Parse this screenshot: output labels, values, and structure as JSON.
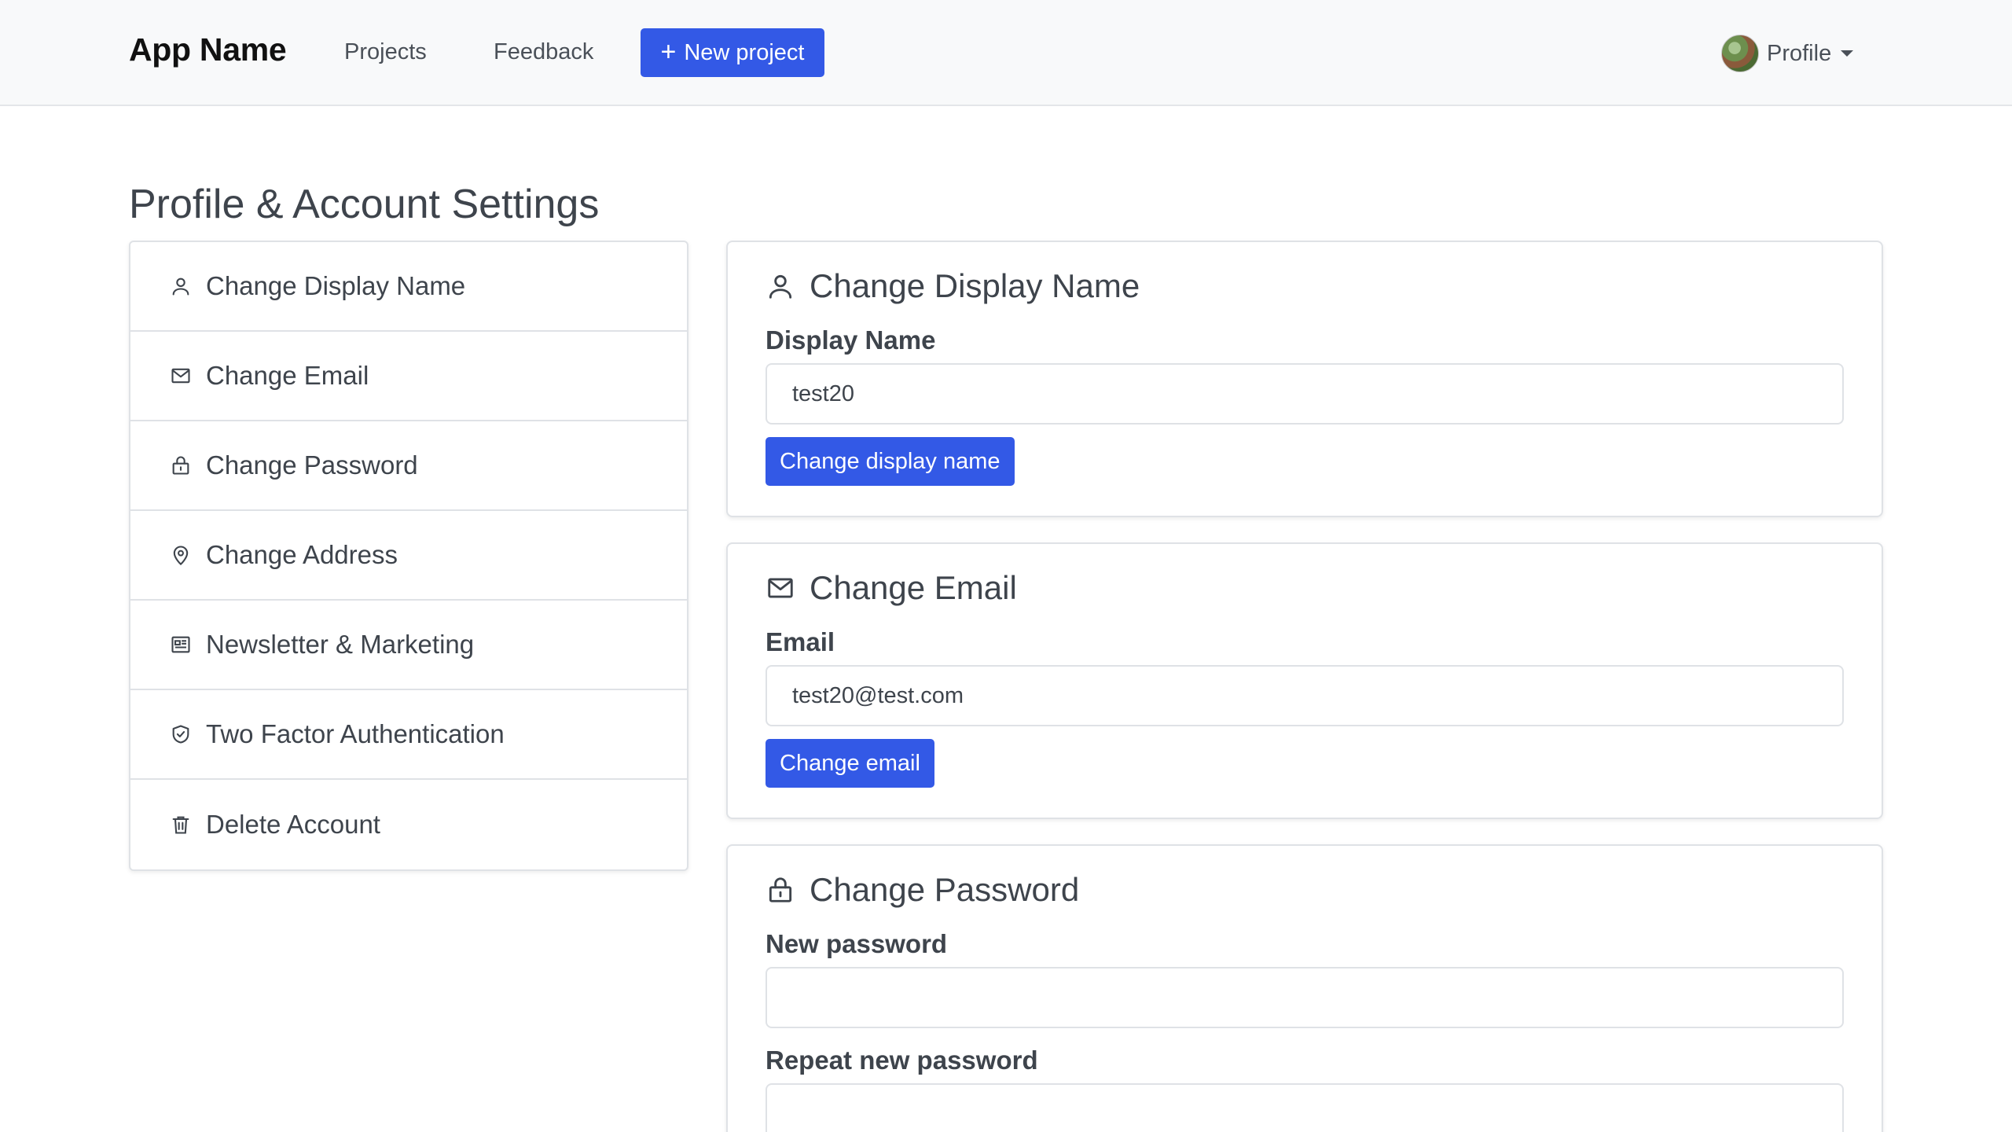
{
  "navbar": {
    "brand": "App Name",
    "links": [
      "Projects",
      "Feedback"
    ],
    "new_project_label": "New project",
    "profile_label": "Profile"
  },
  "page": {
    "title": "Profile & Account Settings"
  },
  "sidebar": {
    "items": [
      {
        "label": "Change Display Name",
        "icon": "user-icon"
      },
      {
        "label": "Change Email",
        "icon": "envelope-icon"
      },
      {
        "label": "Change Password",
        "icon": "lock-icon"
      },
      {
        "label": "Change Address",
        "icon": "map-pin-icon"
      },
      {
        "label": "Newsletter & Marketing",
        "icon": "newspaper-icon"
      },
      {
        "label": "Two Factor Authentication",
        "icon": "shield-check-icon"
      },
      {
        "label": "Delete Account",
        "icon": "trash-icon"
      }
    ]
  },
  "cards": {
    "display_name": {
      "title": "Change Display Name",
      "field_label": "Display Name",
      "value": "test20",
      "button": "Change display name"
    },
    "email": {
      "title": "Change Email",
      "field_label": "Email",
      "value": "test20@test.com",
      "button": "Change email"
    },
    "password": {
      "title": "Change Password",
      "new_label": "New password",
      "new_value": "",
      "repeat_label": "Repeat new password",
      "repeat_value": ""
    }
  },
  "colors": {
    "primary": "#3359e6",
    "navbar_bg": "#f8f9fa",
    "text": "#3e444c",
    "border": "#dfe2e6"
  }
}
